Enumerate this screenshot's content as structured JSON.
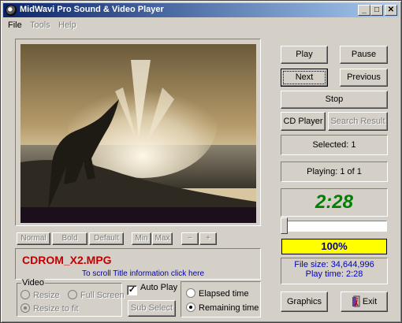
{
  "window": {
    "title": "MidWavi Pro Sound & Video Player",
    "minimize": "_",
    "maximize": "□",
    "close": "✕"
  },
  "menu": [
    {
      "label": "File",
      "enabled": true
    },
    {
      "label": "Tools",
      "enabled": false
    },
    {
      "label": "Help",
      "enabled": false
    }
  ],
  "video": {
    "scene": "dinosaur on beach with explosion"
  },
  "format_buttons": {
    "normal": "Normal",
    "bold": "Bold",
    "default": "Default",
    "min": "Min",
    "max": "Max",
    "minus": "−",
    "plus": "+"
  },
  "title_panel": {
    "filename": "CDROM_X2.MPG",
    "hint": "To scroll Title information click here"
  },
  "video_group": {
    "caption": "Video",
    "resize": "Resize",
    "full_screen": "Full Screen",
    "resize_to_fit": "Resize  to fit"
  },
  "auto_play": {
    "label": "Auto Play",
    "checked": true,
    "sub_select": "Sub Select"
  },
  "time_mode": {
    "elapsed": "Elapsed time",
    "remaining": "Remaining time",
    "selected": "remaining"
  },
  "controls": {
    "play": "Play",
    "pause": "Pause",
    "next": "Next",
    "previous": "Previous",
    "stop": "Stop",
    "cd_player": "CD Player",
    "search_result": "Search Result",
    "graphics": "Graphics",
    "exit": "Exit"
  },
  "status": {
    "selected": "Selected: 1",
    "playing": "Playing: 1 of 1",
    "time": "2:28",
    "volume_percent": "100%",
    "volume_level": 1.0,
    "position_level": 0.0,
    "file_size": "File size: 34,644,996",
    "play_time": "Play time: 2:28"
  },
  "colors": {
    "face": "#d4d0c8",
    "title_start": "#0a246a",
    "title_end": "#a6caf0",
    "timer": "#008000",
    "filename": "#c00000",
    "info": "#0000c0",
    "progress": "#ffff00"
  }
}
